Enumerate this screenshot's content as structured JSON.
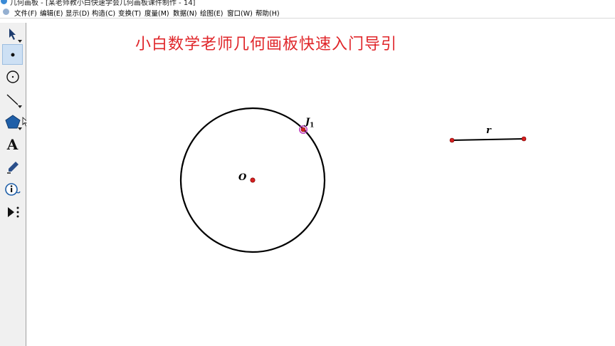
{
  "window": {
    "title": "几何画板 - [某老师教小白快速学会几何画板课件制作 - 14]"
  },
  "menu": {
    "items": [
      {
        "label": "文件(F)"
      },
      {
        "label": "编辑(E)"
      },
      {
        "label": "显示(D)"
      },
      {
        "label": "构造(C)"
      },
      {
        "label": "变换(T)"
      },
      {
        "label": "度量(M)"
      },
      {
        "label": "数据(N)"
      },
      {
        "label": "绘图(E)"
      },
      {
        "label": "窗口(W)"
      },
      {
        "label": "帮助(H)"
      }
    ]
  },
  "toolbox": {
    "tools": [
      {
        "name": "arrow-tool-icon",
        "active": false
      },
      {
        "name": "point-tool-icon",
        "active": true
      },
      {
        "name": "compass-tool-icon",
        "active": false
      },
      {
        "name": "straightedge-tool-icon",
        "active": false
      },
      {
        "name": "polygon-tool-icon",
        "active": false
      },
      {
        "name": "text-tool-icon",
        "glyph": "A",
        "active": false
      },
      {
        "name": "marker-tool-icon",
        "active": false
      },
      {
        "name": "information-tool-icon",
        "active": false
      },
      {
        "name": "custom-tool-icon",
        "active": false
      }
    ]
  },
  "canvas": {
    "heading": "小白数学老师几何画板快速入门导引",
    "heading_color": "#e0262a",
    "labels": {
      "center": "O",
      "circle_point": "J",
      "circle_point_sub": "1",
      "segment": "r"
    },
    "point_color": "#d42020",
    "selected_point_ring": "#c040c0"
  }
}
